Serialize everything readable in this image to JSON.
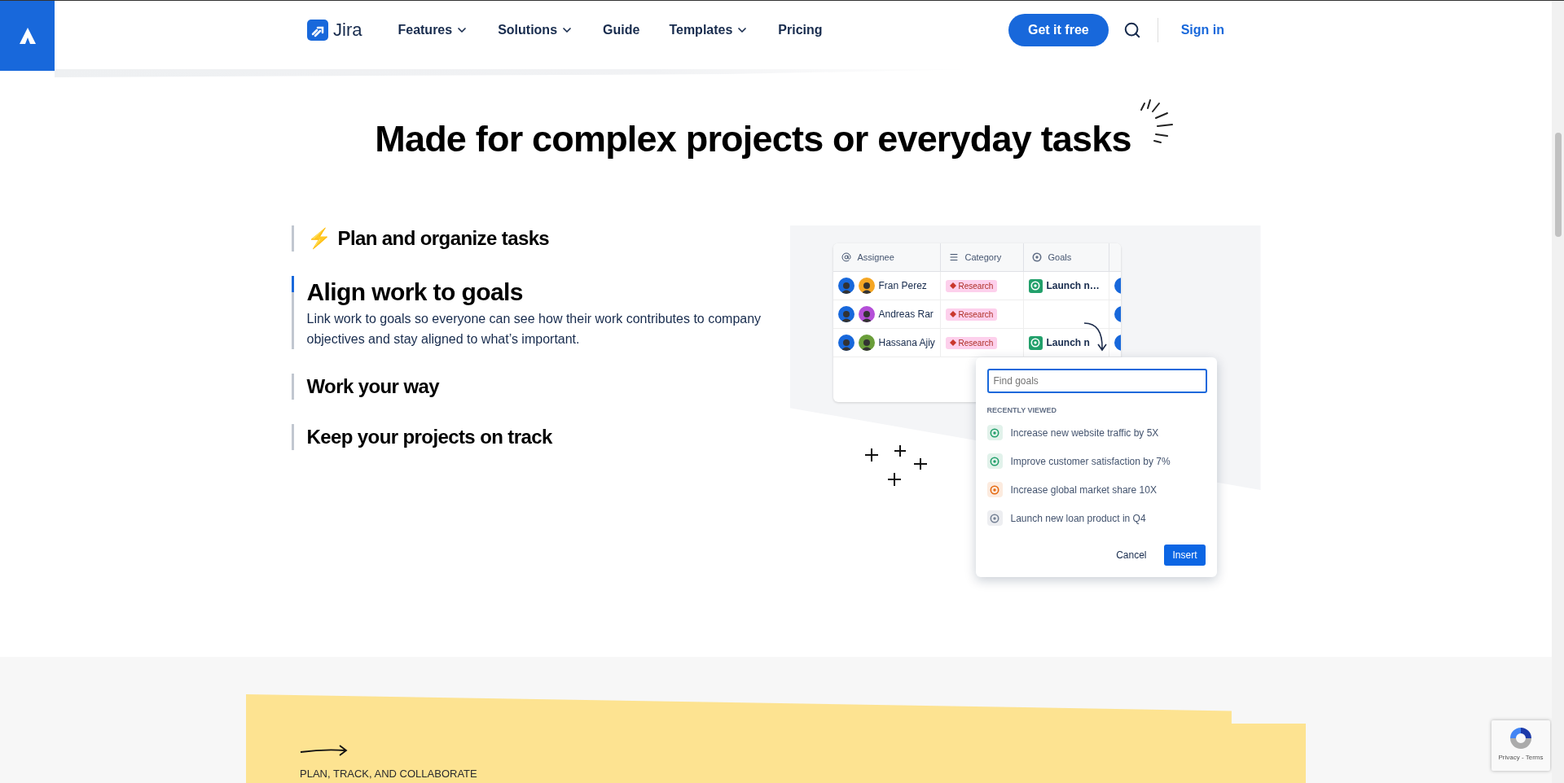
{
  "header": {
    "brand": "Jira",
    "nav": [
      {
        "label": "Features",
        "dropdown": true
      },
      {
        "label": "Solutions",
        "dropdown": true
      },
      {
        "label": "Guide",
        "dropdown": false
      },
      {
        "label": "Templates",
        "dropdown": true
      },
      {
        "label": "Pricing",
        "dropdown": false
      }
    ],
    "cta": "Get it free",
    "sign_in": "Sign in"
  },
  "headline": "Made for complex projects or everyday tasks",
  "features": [
    {
      "emoji": "⚡",
      "title": "Plan and organize tasks",
      "expanded": false
    },
    {
      "title": "Align work to goals",
      "description": "Link work to goals so everyone can see how their work contributes to company objectives and stay aligned to what’s important.",
      "expanded": true
    },
    {
      "title": "Work your way",
      "expanded": false
    },
    {
      "title": "Keep your projects on track",
      "expanded": false
    }
  ],
  "mockup": {
    "columns": [
      "Assignee",
      "Category",
      "Goals"
    ],
    "rows": [
      {
        "name": "Fran Perez",
        "color": "#f5a623",
        "category": "Research",
        "goal": "Launch n…"
      },
      {
        "name": "Andreas Rar",
        "color": "#b44fd8",
        "category": "Research"
      },
      {
        "name": "Hassana Ajiy",
        "color": "#6a9e3a",
        "category": "Research",
        "goal": "Launch n"
      }
    ],
    "popup": {
      "placeholder": "Find goals",
      "section": "RECENTLY VIEWED",
      "goals": [
        {
          "label": "Increase new website traffic by 5X",
          "color": "#22a06b"
        },
        {
          "label": "Improve customer satisfaction by 7%",
          "color": "#22a06b"
        },
        {
          "label": "Increase global market share 10X",
          "color": "#e56910"
        },
        {
          "label": "Launch new loan product in Q4",
          "color": "#758195"
        }
      ],
      "buttons": [
        "Cancel",
        "Insert"
      ]
    }
  },
  "banner": {
    "eyebrow": "PLAN, TRACK, AND COLLABORATE"
  },
  "recaptcha": {
    "links": "Privacy - Terms"
  }
}
